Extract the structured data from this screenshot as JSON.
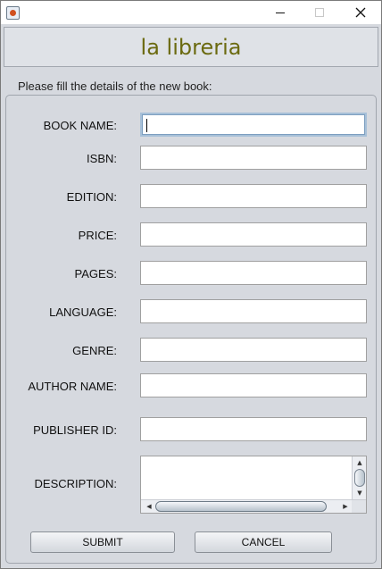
{
  "window": {
    "controls": {
      "minimize": "minimize",
      "maximize": "maximize",
      "close": "✕"
    }
  },
  "header": {
    "title": "la libreria"
  },
  "form": {
    "instruction": "Please fill the details of the new book:",
    "fields": {
      "book_name": {
        "label": "BOOK NAME:",
        "value": ""
      },
      "isbn": {
        "label": "ISBN:",
        "value": ""
      },
      "edition": {
        "label": "EDITION:",
        "value": ""
      },
      "price": {
        "label": "PRICE:",
        "value": ""
      },
      "pages": {
        "label": "PAGES:",
        "value": ""
      },
      "language": {
        "label": "LANGUAGE:",
        "value": ""
      },
      "genre": {
        "label": "GENRE:",
        "value": ""
      },
      "author_name": {
        "label": "AUTHOR NAME:",
        "value": ""
      },
      "publisher_id": {
        "label": "PUBLISHER ID:",
        "value": ""
      },
      "description": {
        "label": "DESCRIPTION:",
        "value": ""
      }
    },
    "scroll_arrows": {
      "up": "▲",
      "down": "▼",
      "left": "◀",
      "right": "▶"
    },
    "buttons": {
      "submit": "SUBMIT",
      "cancel": "CANCEL"
    }
  }
}
